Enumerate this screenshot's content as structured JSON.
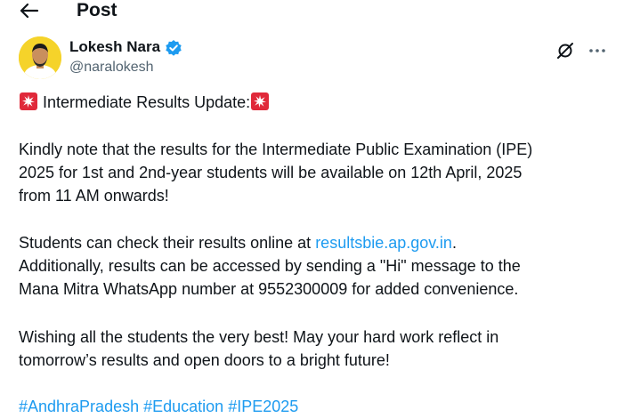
{
  "header": {
    "title": "Post",
    "back_icon": "arrow-left-icon"
  },
  "author": {
    "name": "Lokesh Nara",
    "handle": "@naralokesh",
    "verified_color": "#1d9bf0",
    "avatar_bg": "#f5d32a"
  },
  "post": {
    "title_line": "Intermediate Results Update:",
    "para1": [
      "Kindly note that the results for the Intermediate Public Examination (IPE)",
      "2025 for 1st and 2nd-year students will be available on 12th April, 2025",
      "from 11 AM onwards!"
    ],
    "para2_line1_prefix": "Students can check their results online at ",
    "para2_link": "resultsbie.ap.gov.in",
    "para2_line1_suffix": ".",
    "para2_rest": [
      "Additionally, results can be accessed by sending a \"Hi\" message to the",
      "Mana Mitra WhatsApp number at 9552300009 for added convenience."
    ],
    "para3": [
      "Wishing all the students the very best! May your hard work reflect in",
      "tomorrow’s results and open doors to a bright future!"
    ],
    "hashtags": [
      "#AndhraPradesh",
      "#Education",
      "#IPE2025"
    ]
  },
  "colors": {
    "link": "#1d9bf0",
    "text": "#0f1419",
    "secondary": "#536471",
    "siren": "#e0293a"
  }
}
